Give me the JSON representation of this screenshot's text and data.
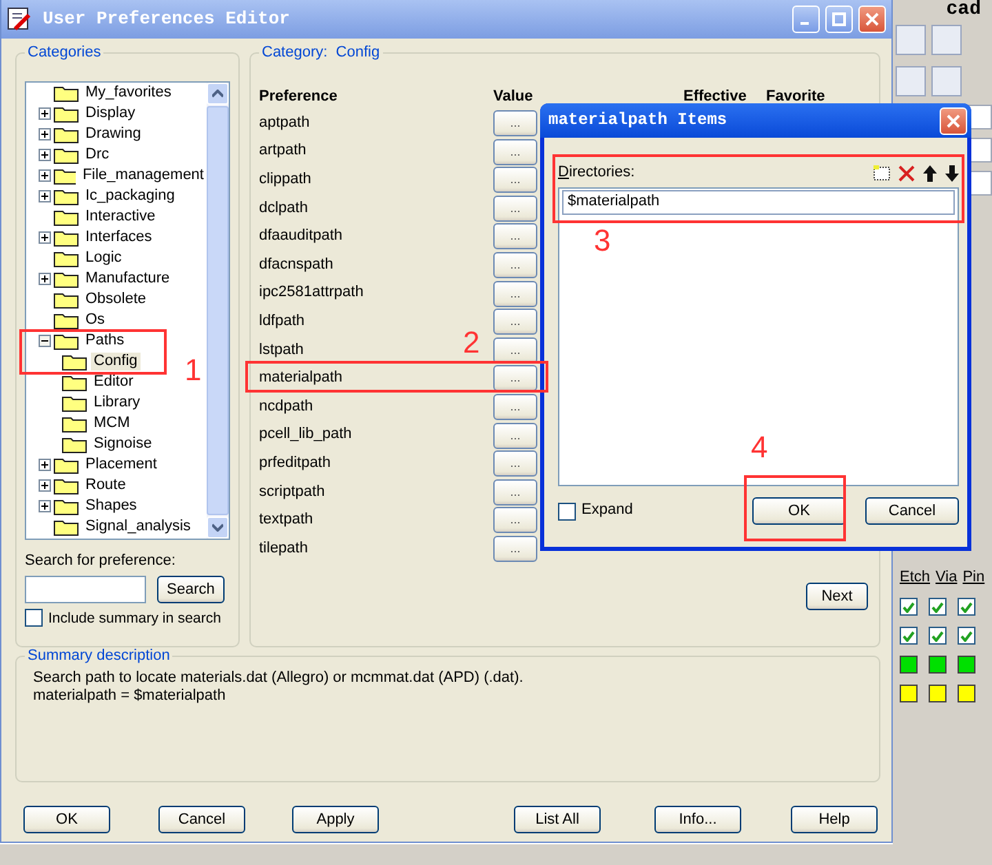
{
  "window": {
    "title": "User Preferences Editor"
  },
  "categories": {
    "legend": "Categories",
    "tree": [
      {
        "label": "My_favorites",
        "kind": "leaf",
        "selected": false
      },
      {
        "label": "Display",
        "kind": "branch",
        "expanded": false,
        "selected": false
      },
      {
        "label": "Drawing",
        "kind": "branch",
        "expanded": false,
        "selected": false
      },
      {
        "label": "Drc",
        "kind": "branch",
        "expanded": false,
        "selected": false
      },
      {
        "label": "File_management",
        "kind": "branch",
        "expanded": false,
        "selected": false
      },
      {
        "label": "Ic_packaging",
        "kind": "branch",
        "expanded": false,
        "selected": false
      },
      {
        "label": "Interactive",
        "kind": "leaf",
        "selected": false
      },
      {
        "label": "Interfaces",
        "kind": "branch",
        "expanded": false,
        "selected": false
      },
      {
        "label": "Logic",
        "kind": "leaf",
        "selected": false
      },
      {
        "label": "Manufacture",
        "kind": "branch",
        "expanded": false,
        "selected": false
      },
      {
        "label": "Obsolete",
        "kind": "leaf",
        "selected": false
      },
      {
        "label": "Os",
        "kind": "leaf",
        "selected": false
      },
      {
        "label": "Paths",
        "kind": "branch",
        "expanded": true,
        "selected": false,
        "children": [
          {
            "label": "Config",
            "kind": "leaf",
            "selected": true
          },
          {
            "label": "Editor",
            "kind": "leaf",
            "selected": false
          },
          {
            "label": "Library",
            "kind": "leaf",
            "selected": false
          },
          {
            "label": "MCM",
            "kind": "leaf",
            "selected": false
          },
          {
            "label": "Signoise",
            "kind": "leaf",
            "selected": false
          }
        ]
      },
      {
        "label": "Placement",
        "kind": "branch",
        "expanded": false,
        "selected": false
      },
      {
        "label": "Route",
        "kind": "branch",
        "expanded": false,
        "selected": false
      },
      {
        "label": "Shapes",
        "kind": "branch",
        "expanded": false,
        "selected": false
      },
      {
        "label": "Signal_analysis",
        "kind": "leaf",
        "selected": false
      }
    ],
    "search": {
      "label": "Search for preference:",
      "button": "Search",
      "include_summary": {
        "label": "Include summary in search",
        "checked": false
      }
    }
  },
  "category_panel": {
    "legend_label": "Category:",
    "legend_value": "Config",
    "columns": [
      "Preference",
      "Value",
      "Effective",
      "Favorite"
    ],
    "preferences": [
      {
        "name": "aptpath",
        "button": "..."
      },
      {
        "name": "artpath",
        "button": "..."
      },
      {
        "name": "clippath",
        "button": "..."
      },
      {
        "name": "dclpath",
        "button": "..."
      },
      {
        "name": "dfaauditpath",
        "button": "..."
      },
      {
        "name": "dfacnspath",
        "button": "..."
      },
      {
        "name": "ipc2581attrpath",
        "button": "..."
      },
      {
        "name": "ldfpath",
        "button": "..."
      },
      {
        "name": "lstpath",
        "button": "..."
      },
      {
        "name": "materialpath",
        "button": "..."
      },
      {
        "name": "ncdpath",
        "button": "..."
      },
      {
        "name": "pcell_lib_path",
        "button": "..."
      },
      {
        "name": "prfeditpath",
        "button": "..."
      },
      {
        "name": "scriptpath",
        "button": "..."
      },
      {
        "name": "textpath",
        "button": "..."
      },
      {
        "name": "tilepath",
        "button": "..."
      }
    ],
    "next_button": "Next"
  },
  "summary": {
    "legend": "Summary description",
    "lines": [
      "Search path to locate materials.dat (Allegro) or mcmmat.dat (APD) (.dat).",
      "materialpath = $materialpath"
    ]
  },
  "buttons": [
    "OK",
    "Cancel",
    "Apply",
    "List All",
    "Info...",
    "Help"
  ],
  "dialog": {
    "title": "materialpath Items",
    "list_label": "Directories:",
    "items": [
      {
        "text": "$materialpath",
        "selected": true
      }
    ],
    "expand": {
      "label": "Expand",
      "checked": false
    },
    "buttons": [
      "OK",
      "Cancel"
    ]
  },
  "background_app": {
    "title_fragment": "cad",
    "layer_columns": [
      "Etch",
      "Via",
      "Pin"
    ],
    "visibility_rows": [
      {
        "cells": [
          {
            "checked": true
          },
          {
            "checked": true
          },
          {
            "checked": true
          }
        ]
      },
      {
        "cells": [
          {
            "checked": true
          },
          {
            "checked": true
          },
          {
            "checked": true
          }
        ]
      }
    ],
    "color_rows": [
      {
        "cells": [
          {
            "color": "#00e000"
          },
          {
            "color": "#00e000"
          },
          {
            "color": "#00e000"
          }
        ]
      },
      {
        "cells": [
          {
            "color": "#ffff00"
          },
          {
            "color": "#ffff00"
          },
          {
            "color": "#ffff00"
          }
        ]
      }
    ]
  },
  "annotations": [
    {
      "label": "1"
    },
    {
      "label": "2"
    },
    {
      "label": "3"
    },
    {
      "label": "4"
    }
  ]
}
